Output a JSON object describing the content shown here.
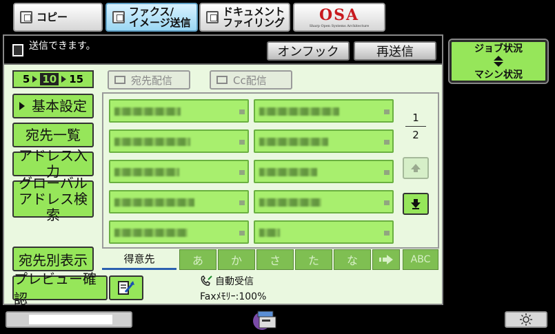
{
  "tabs": [
    {
      "label": "コピー"
    },
    {
      "label": "ファクス/\nイメージ送信"
    },
    {
      "label": "ドキュメント\nファイリング"
    },
    {
      "label": "OSA"
    }
  ],
  "status": {
    "message": "送信できます。",
    "on_hook_label": "オンフック",
    "resend_label": "再送信"
  },
  "counter": {
    "start": "5",
    "current": "10",
    "end": "15"
  },
  "dist": {
    "addressee_label": "宛先配信",
    "cc_label": "Cc配信"
  },
  "left_menu": {
    "basic_settings": "基本設定",
    "address_list": "宛先一覧",
    "address_entry": "アドレス入力",
    "global_search": "グローバル\nアドレス検索",
    "by_address": "宛先別表示",
    "preview": "プレビュー確認"
  },
  "pager": {
    "current": "1",
    "total": "2"
  },
  "index_tabs": [
    "得意先",
    "あ",
    "か",
    "さ",
    "た",
    "な",
    "ABC"
  ],
  "info": {
    "auto_receive": "自動受信",
    "fax_memory": "Faxﾒﾓﾘｰ:100%"
  },
  "job": {
    "job_status": "ジョブ状況",
    "machine_status": "マシン状況"
  },
  "footer": {
    "progress_fraction": 0.66
  },
  "colors": {
    "accent_green": "#96e65a",
    "panel_bg": "#eaf8e0",
    "active_tab": "#9bd7f3",
    "logo_red": "#c8191e"
  },
  "icons": [
    "copy-icon",
    "fax-icon",
    "filing-icon",
    "document-icon",
    "mail-icon",
    "cc-icon",
    "up-arrow-icon",
    "down-arrow-icon",
    "phone-icon",
    "preview-edit-icon",
    "machine-icon",
    "brightness-icon"
  ]
}
